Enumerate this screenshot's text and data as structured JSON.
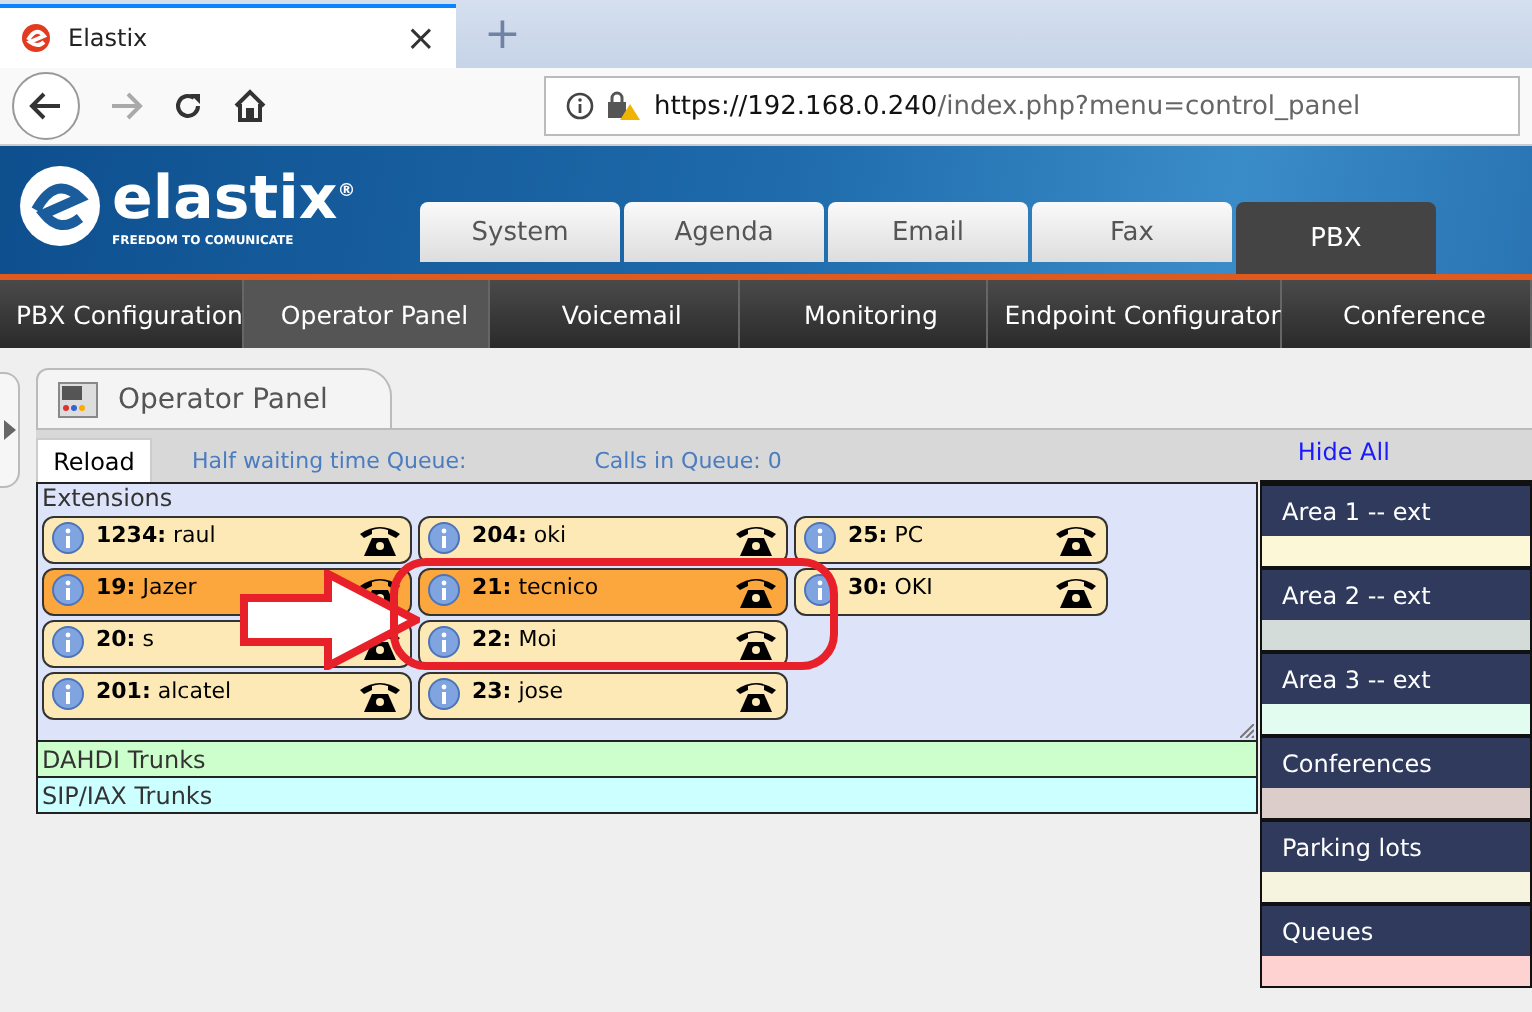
{
  "browser": {
    "tab_title": "Elastix",
    "new_tab": "+",
    "close": "×",
    "url_host": "https://192.168.0.240",
    "url_path": "/index.php?menu=control_panel"
  },
  "logo": {
    "name": "elastix",
    "reg": "®",
    "tagline": "FREEDOM TO COMUNICATE"
  },
  "tabs": [
    {
      "label": "System",
      "selected": false
    },
    {
      "label": "Agenda",
      "selected": false
    },
    {
      "label": "Email",
      "selected": false
    },
    {
      "label": "Fax",
      "selected": false
    },
    {
      "label": "PBX",
      "selected": true
    }
  ],
  "submenu": [
    {
      "label": "PBX Configuration",
      "selected": false
    },
    {
      "label": "Operator Panel",
      "selected": true
    },
    {
      "label": "Voicemail",
      "selected": false
    },
    {
      "label": "Monitoring",
      "selected": false
    },
    {
      "label": "Endpoint Configurator",
      "selected": false
    },
    {
      "label": "Conference",
      "selected": false
    }
  ],
  "page_title": "Operator Panel",
  "toolbar": {
    "reload": "Reload",
    "half_waiting": "Half waiting time Queue:",
    "calls_in_queue": "Calls in Queue: 0",
    "hide_all": "Hide All"
  },
  "extensions": {
    "title": "Extensions",
    "columns": [
      [
        {
          "label": "**1234:** raul",
          "active": false
        },
        {
          "label": "**19:** Jazer",
          "active": true
        },
        {
          "label": "**20:** s",
          "active": false
        },
        {
          "label": "**201:** alcatel",
          "active": false
        }
      ],
      [
        {
          "label": "**204:** oki",
          "active": false
        },
        {
          "label": "**21:** tecnico",
          "active": true
        },
        {
          "label": "**22:** Moi",
          "active": false
        },
        {
          "label": "**23:** jose",
          "active": false
        }
      ],
      [
        {
          "label": "**25:** PC",
          "active": false
        },
        {
          "label": "**30:** OKI",
          "active": false
        }
      ]
    ]
  },
  "trunks": [
    {
      "label": "DAHDI Trunks",
      "color": "#ccffcc"
    },
    {
      "label": "SIP/IAX Trunks",
      "color": "#ccffff"
    }
  ],
  "areas": [
    {
      "label": "Area 1 -- ext",
      "color": "#fcf7d6"
    },
    {
      "label": "Area 2 -- ext",
      "color": "#d3dcd8"
    },
    {
      "label": "Area 3 -- ext",
      "color": "#e2fcef"
    },
    {
      "label": "Conferences",
      "color": "#dcccca"
    },
    {
      "label": "Parking lots",
      "color": "#f6f4de"
    },
    {
      "label": "Queues",
      "color": "#ffd2d2"
    }
  ]
}
